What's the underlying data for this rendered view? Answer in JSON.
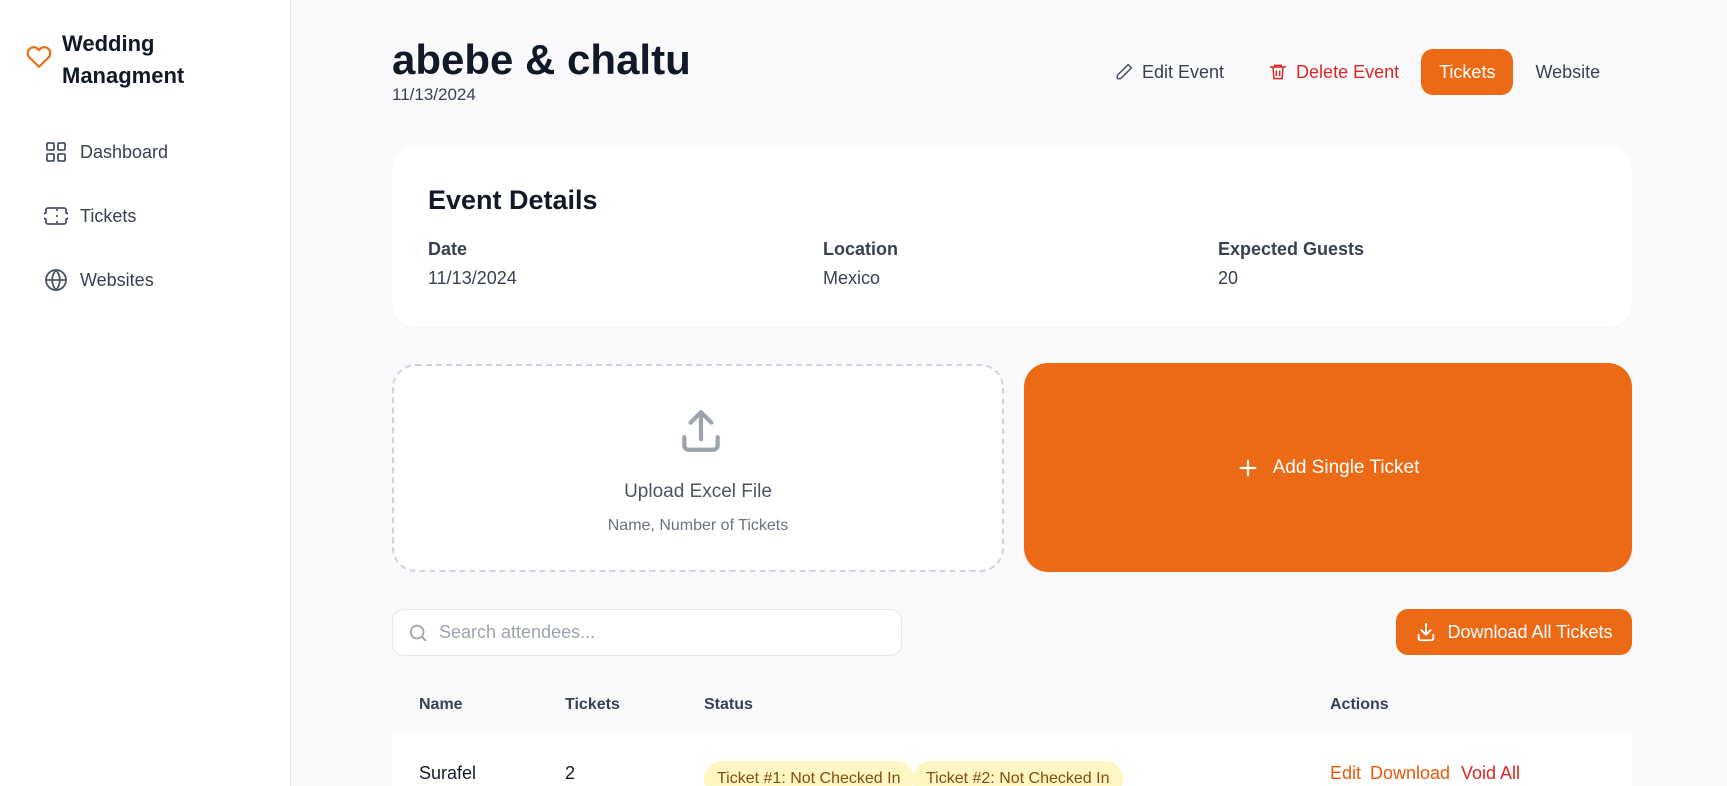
{
  "brand": {
    "title": "Wedding Managment",
    "accent": "#ec6a15"
  },
  "sidebar": {
    "items": [
      {
        "label": "Dashboard",
        "icon": "grid-icon"
      },
      {
        "label": "Tickets",
        "icon": "ticket-icon"
      },
      {
        "label": "Websites",
        "icon": "globe-icon"
      }
    ]
  },
  "header": {
    "title": "abebe & chaltu",
    "date": "11/13/2024",
    "edit_label": "Edit Event",
    "delete_label": "Delete Event",
    "tickets_label": "Tickets",
    "website_label": "Website"
  },
  "event_details": {
    "heading": "Event Details",
    "fields": [
      {
        "label": "Date",
        "value": "11/13/2024"
      },
      {
        "label": "Location",
        "value": "Mexico"
      },
      {
        "label": "Expected Guests",
        "value": "20"
      }
    ]
  },
  "upload": {
    "title": "Upload Excel File",
    "hint": "Name, Number of Tickets"
  },
  "add_ticket": {
    "label": "Add Single Ticket"
  },
  "search": {
    "placeholder": "Search attendees..."
  },
  "download_all": {
    "label": "Download All Tickets"
  },
  "table": {
    "columns": [
      "Name",
      "Tickets",
      "Status",
      "Actions"
    ],
    "rows": [
      {
        "name": "Surafel",
        "tickets": "2",
        "statuses": [
          "Ticket #1: Not Checked In",
          "Ticket #2: Not Checked In"
        ],
        "actions": [
          "Edit",
          "Download",
          "Void All"
        ]
      }
    ]
  }
}
